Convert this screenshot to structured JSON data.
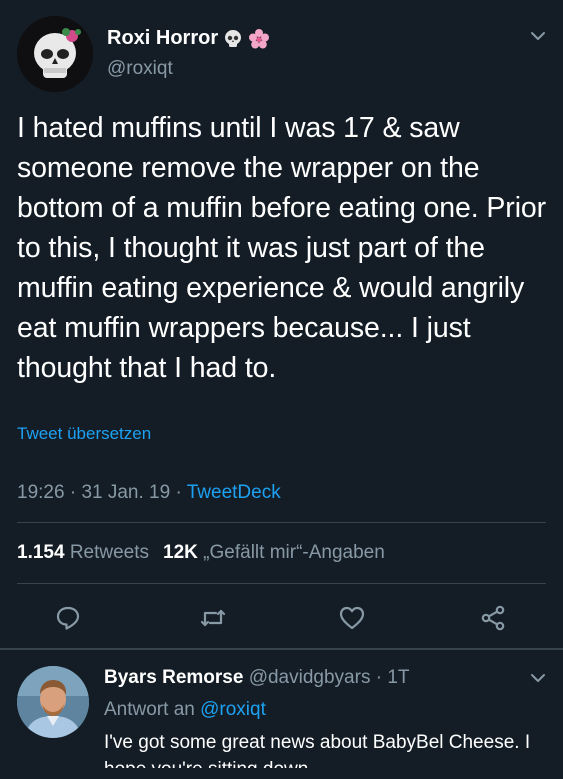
{
  "tweet": {
    "author_name": "Roxi Horror",
    "author_handle": "@roxiqt",
    "emoji_1": "skull-icon",
    "emoji_2": "cherry-blossom-icon",
    "text": "I hated muffins until I was 17 & saw someone remove the wrapper on the bottom of a muffin before eating one. Prior to this, I thought it was just part of the muffin eating experience & would angrily eat muffin wrappers because... I just thought that I had to.",
    "translate_label": "Tweet übersetzen",
    "time": "19:26",
    "date": "31 Jan. 19",
    "separator": "·",
    "source": "TweetDeck",
    "retweets_count": "1.154",
    "retweets_label": "Retweets",
    "likes_count": "12K",
    "likes_label": "„Gefällt mir“-Angaben"
  },
  "actions": {
    "reply": "reply-icon",
    "retweet": "retweet-icon",
    "like": "heart-icon",
    "share": "share-icon"
  },
  "reply": {
    "author_name": "Byars Remorse",
    "author_handle": "@davidgbyars",
    "separator": "·",
    "time_ago": "1T",
    "reply_to_label": "Antwort an",
    "reply_to_handle": "@roxiqt",
    "text": "I've got some great news about BabyBel Cheese. I hope you're sitting down..."
  },
  "colors": {
    "background": "#141d26",
    "accent": "#1da1f2",
    "secondary_text": "#8899a6",
    "divider": "#38444d"
  }
}
